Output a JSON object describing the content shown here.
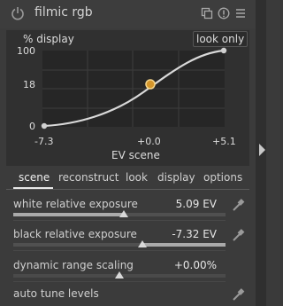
{
  "header": {
    "title": "filmic rgb",
    "icons": [
      "power-icon",
      "presets-icon",
      "reset-icon",
      "menu-icon"
    ]
  },
  "graph": {
    "y_axis_title": "% display",
    "badge": "look only",
    "y_ticks": [
      "100",
      "18",
      "0"
    ],
    "x_ticks": [
      "-7.3",
      "+0.0",
      "+5.1"
    ],
    "x_axis_title": "EV scene",
    "curve_color": "#d9d9d9",
    "grey_point_color": "#e0a030"
  },
  "tabs": {
    "items": [
      "scene",
      "reconstruct",
      "look",
      "display",
      "options"
    ],
    "active": "scene"
  },
  "sliders": [
    {
      "label": "white relative exposure",
      "value": "5.09 EV",
      "position": 0.52,
      "mode": "fill_left",
      "has_picker": true
    },
    {
      "label": "black relative exposure",
      "value": "-7.32 EV",
      "position": 0.61,
      "mode": "fill_right",
      "has_picker": true
    },
    {
      "label": "dynamic range scaling",
      "value": "+0.00%",
      "position": 0.5,
      "mode": "none",
      "has_picker": false
    }
  ],
  "auto_tune": {
    "label": "auto tune levels"
  }
}
